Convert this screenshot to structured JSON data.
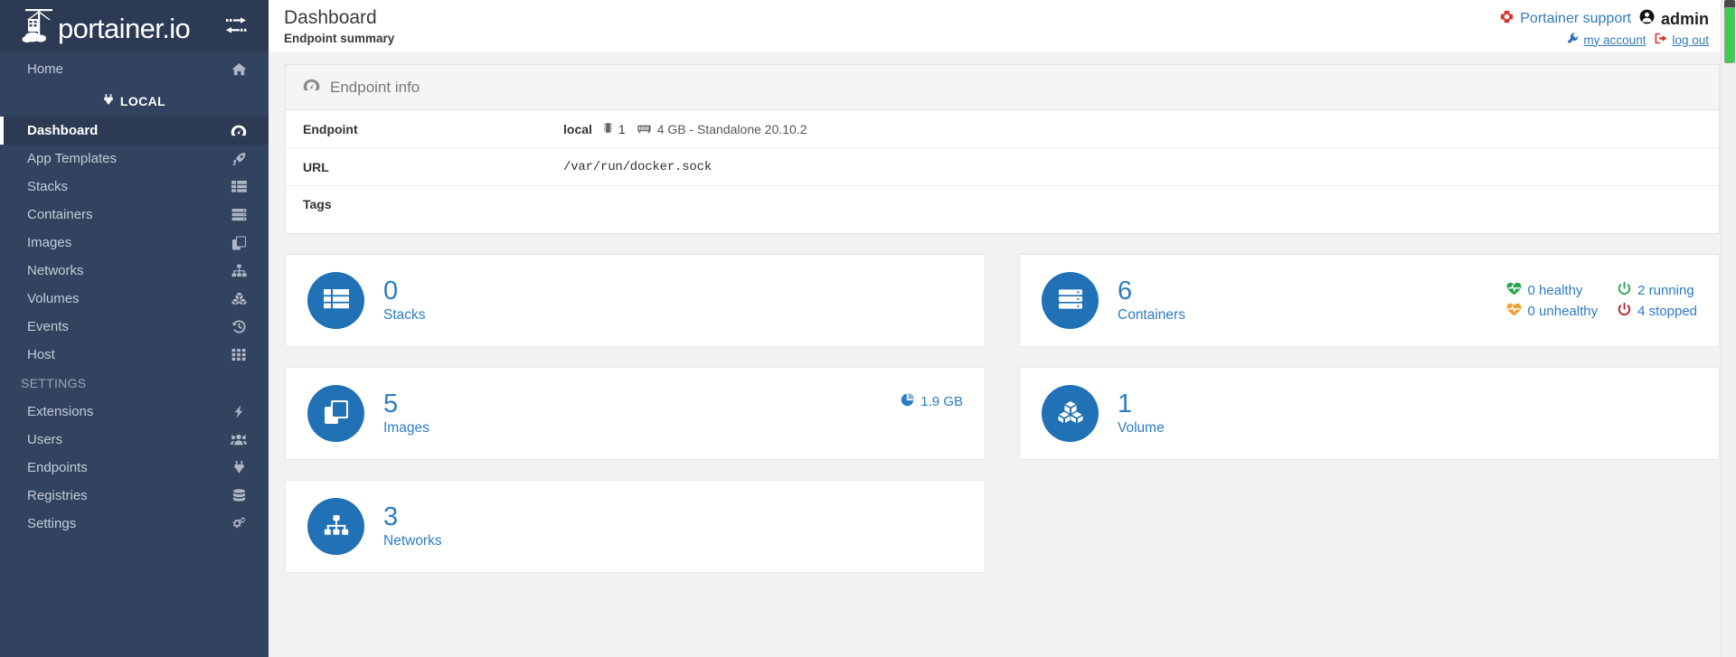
{
  "brand": {
    "name": "portainer.io",
    "toggle_icon": "arrows-toggle-icon"
  },
  "sidebar": {
    "home": {
      "label": "Home",
      "icon": "home-icon"
    },
    "local_section": {
      "label": "LOCAL",
      "icon": "plug-icon"
    },
    "items": [
      {
        "label": "Dashboard",
        "icon": "dashboard-gauge-icon",
        "active": true
      },
      {
        "label": "App Templates",
        "icon": "rocket-icon",
        "active": false
      },
      {
        "label": "Stacks",
        "icon": "table-list-icon",
        "active": false
      },
      {
        "label": "Containers",
        "icon": "server-stack-icon",
        "active": false
      },
      {
        "label": "Images",
        "icon": "copy-layers-icon",
        "active": false
      },
      {
        "label": "Networks",
        "icon": "sitemap-icon",
        "active": false
      },
      {
        "label": "Volumes",
        "icon": "cubes-icon",
        "active": false
      },
      {
        "label": "Events",
        "icon": "history-clock-icon",
        "active": false
      },
      {
        "label": "Host",
        "icon": "grid-th-icon",
        "active": false
      }
    ],
    "settings_section": {
      "label": "SETTINGS"
    },
    "settings_items": [
      {
        "label": "Extensions",
        "icon": "bolt-icon"
      },
      {
        "label": "Users",
        "icon": "users-icon"
      },
      {
        "label": "Endpoints",
        "icon": "plug-icon"
      },
      {
        "label": "Registries",
        "icon": "database-icon"
      },
      {
        "label": "Settings",
        "icon": "cogs-icon"
      }
    ]
  },
  "header": {
    "title": "Dashboard",
    "subtitle": "Endpoint summary",
    "support_label": "Portainer support",
    "support_icon": "lifebuoy-icon",
    "user_name": "admin",
    "user_icon": "user-circle-icon",
    "my_account_label": "my account",
    "my_account_icon": "wrench-icon",
    "logout_label": "log out",
    "logout_icon": "sign-out-icon"
  },
  "endpoint_info": {
    "panel_title": "Endpoint info",
    "panel_icon": "gauge-icon",
    "rows": [
      {
        "key": "Endpoint",
        "value": "local",
        "cpu_icon": "cpu-icon",
        "cpu": "1",
        "mem_icon": "memory-icon",
        "mem": "4 GB - Standalone 20.10.2"
      },
      {
        "key": "URL",
        "value": "/var/run/docker.sock"
      },
      {
        "key": "Tags",
        "value": ""
      }
    ]
  },
  "cards": {
    "stacks": {
      "count": "0",
      "label": "Stacks",
      "icon": "table-list-icon"
    },
    "containers": {
      "count": "6",
      "label": "Containers",
      "icon": "server-stack-icon",
      "stats": [
        {
          "icon": "heartbeat-green-icon",
          "text": "0 healthy",
          "color": "#2aa44f"
        },
        {
          "icon": "power-green-icon",
          "text": "2 running",
          "color": "#23a455"
        },
        {
          "icon": "heartbeat-orange-icon",
          "text": "0 unhealthy",
          "color": "#f0a030"
        },
        {
          "icon": "power-red-icon",
          "text": "4 stopped",
          "color": "#b02020"
        }
      ]
    },
    "images": {
      "count": "5",
      "label": "Images",
      "icon": "copy-layers-icon",
      "size": "1.9 GB",
      "size_icon": "pie-chart-icon"
    },
    "volumes": {
      "count": "1",
      "label": "Volume",
      "icon": "cubes-icon"
    },
    "networks": {
      "count": "3",
      "label": "Networks",
      "icon": "sitemap-icon"
    }
  },
  "colors": {
    "sidebar_bg": "#32435f",
    "sidebar_active_bg": "#2c3a54",
    "accent_blue": "#2d7cc4",
    "circle_blue": "#2071b5",
    "link_blue": "#337ab7",
    "page_bg": "#f2f2f2"
  }
}
